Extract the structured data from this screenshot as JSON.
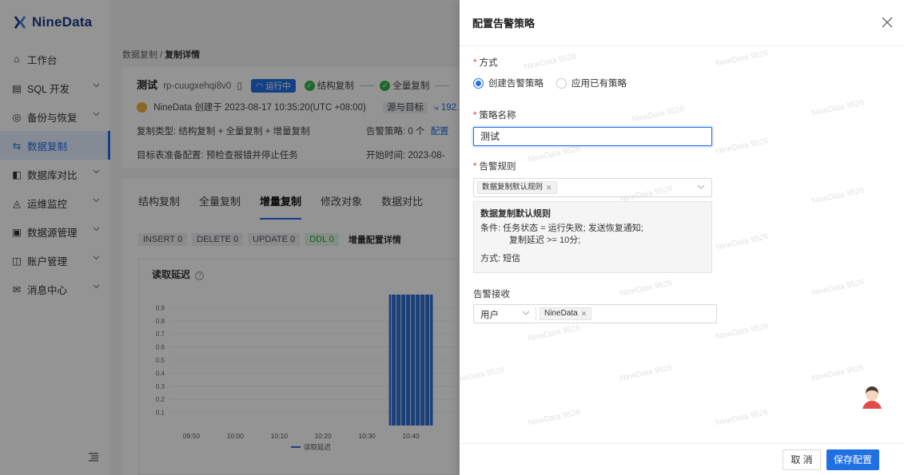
{
  "brand": {
    "name": "NineData",
    "color": "#1b3a8a",
    "accent": "#1f6fe5"
  },
  "sidebar": {
    "items": [
      {
        "label": "工作台",
        "icon": "home-icon",
        "chevron": false
      },
      {
        "label": "SQL 开发",
        "icon": "terminal-icon",
        "chevron": true
      },
      {
        "label": "备份与恢复",
        "icon": "backup-icon",
        "chevron": true
      },
      {
        "label": "数据复制",
        "icon": "replicate-icon",
        "chevron": false,
        "active": true
      },
      {
        "label": "数据库对比",
        "icon": "compare-icon",
        "chevron": true
      },
      {
        "label": "运维监控",
        "icon": "monitor-icon",
        "chevron": true
      },
      {
        "label": "数据源管理",
        "icon": "datasource-icon",
        "chevron": true
      },
      {
        "label": "账户管理",
        "icon": "account-icon",
        "chevron": true
      },
      {
        "label": "消息中心",
        "icon": "message-icon",
        "chevron": true
      }
    ]
  },
  "breadcrumb": {
    "parent": "数据复制",
    "sep": "/",
    "current": "复制详情"
  },
  "task": {
    "name": "测试",
    "id": "rp-cuugxehqi8v0",
    "status": "运行中",
    "step1": "结构复制",
    "step2": "全量复制",
    "creator_line": "NineData 创建于 2023-08-17 10:35:20(UTC +08:00)",
    "src_label": "源与目标",
    "src_value": "192.16",
    "type_line": "复制类型: 结构复制 + 全量复制 + 增量复制",
    "alert_line": "告警策略: 0 个",
    "alert_link": "配置",
    "target_line": "目标表准备配置: 预检查报错并停止任务",
    "start_line": "开始时间: 2023-08-"
  },
  "tabs": [
    "结构复制",
    "全量复制",
    "增量复制",
    "修改对象",
    "数据对比"
  ],
  "active_tab": 2,
  "ops": {
    "insert_label": "INSERT",
    "insert_value": "0",
    "delete_label": "DELETE",
    "delete_value": "0",
    "update_label": "UPDATE",
    "update_value": "0",
    "ddl_label": "DDL",
    "ddl_value": "0",
    "detail_link": "增量配置详情"
  },
  "chart_data": {
    "type": "bar",
    "title": "读取延迟",
    "x_ticks": [
      "09:50",
      "10:00",
      "10:10",
      "10:20",
      "10:30",
      "10:40"
    ],
    "y_ticks": [
      "0.1",
      "0.2",
      "0.3",
      "0.4",
      "0.5",
      "0.6",
      "0.7",
      "0.8",
      "0.9"
    ],
    "ylim": [
      0,
      1
    ],
    "series": [
      {
        "name": "读取延迟",
        "color": "#2d6fd6",
        "active_from": "10:35",
        "active_to": "10:45",
        "value": 1.0
      }
    ]
  },
  "drawer": {
    "title": "配置告警策略",
    "method_label": "方式",
    "method_options": [
      "创建告警策略",
      "应用已有策略"
    ],
    "method_selected": 0,
    "name_label": "策略名称",
    "name_value": "测试",
    "rules_label": "告警规则",
    "rule_chip": "数据复制默认规则",
    "rule_title": "数据复制默认规则",
    "rule_cond1": "条件: 任务状态 = 运行失败; 发送恢复通知;",
    "rule_cond2": "复制延迟 >= 10分;",
    "rule_method": "方式: 短信",
    "receive_label": "告警接收",
    "receive_type": "用户",
    "receive_chip": "NineData",
    "cancel": "取 消",
    "save": "保存配置",
    "watermark": "NineData 9526"
  }
}
